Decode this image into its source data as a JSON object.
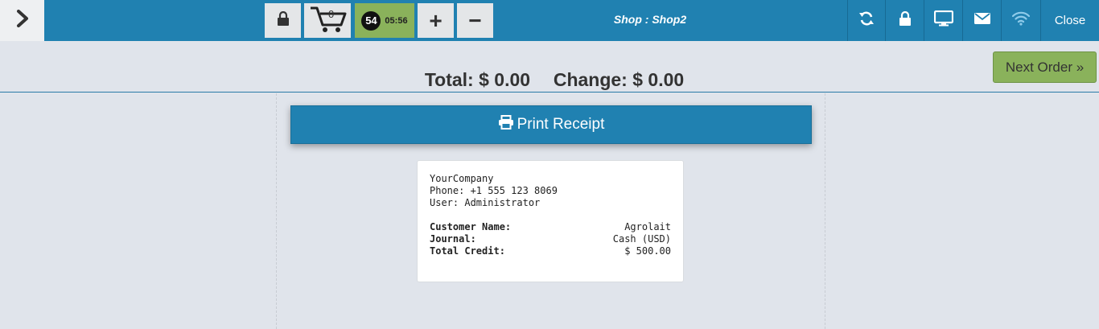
{
  "topbar": {
    "order_count": "0",
    "order_number": "54",
    "order_time": "05:56",
    "plus_label": "+",
    "minus_label": "−",
    "shop_title": "Shop : Shop2",
    "close_label": "Close"
  },
  "icons": {
    "toggle": "chevron-right-icon",
    "lock": "lock-icon",
    "cart": "cart-icon",
    "sync": "refresh-icon",
    "screen": "desktop-icon",
    "mail": "envelope-icon",
    "wifi": "wifi-icon",
    "print": "printer-icon"
  },
  "header": {
    "total_label": "Total:",
    "total_value": "$ 0.00",
    "change_label": "Change:",
    "change_value": "$ 0.00",
    "next_order_label": "Next Order »"
  },
  "print_button": {
    "label": "Print Receipt"
  },
  "receipt": {
    "company": "YourCompany",
    "phone": "Phone: +1 555 123 8069",
    "user": "User: Administrator",
    "rows": [
      {
        "label": "Customer Name:",
        "value": "Agrolait"
      },
      {
        "label": "Journal:",
        "value": "Cash (USD)"
      },
      {
        "label": "Total Credit:",
        "value": "$ 500.00"
      }
    ]
  },
  "colors": {
    "primary_blue": "#2081b1",
    "accent_green": "#8ab25b",
    "background": "#e0e4eb"
  }
}
